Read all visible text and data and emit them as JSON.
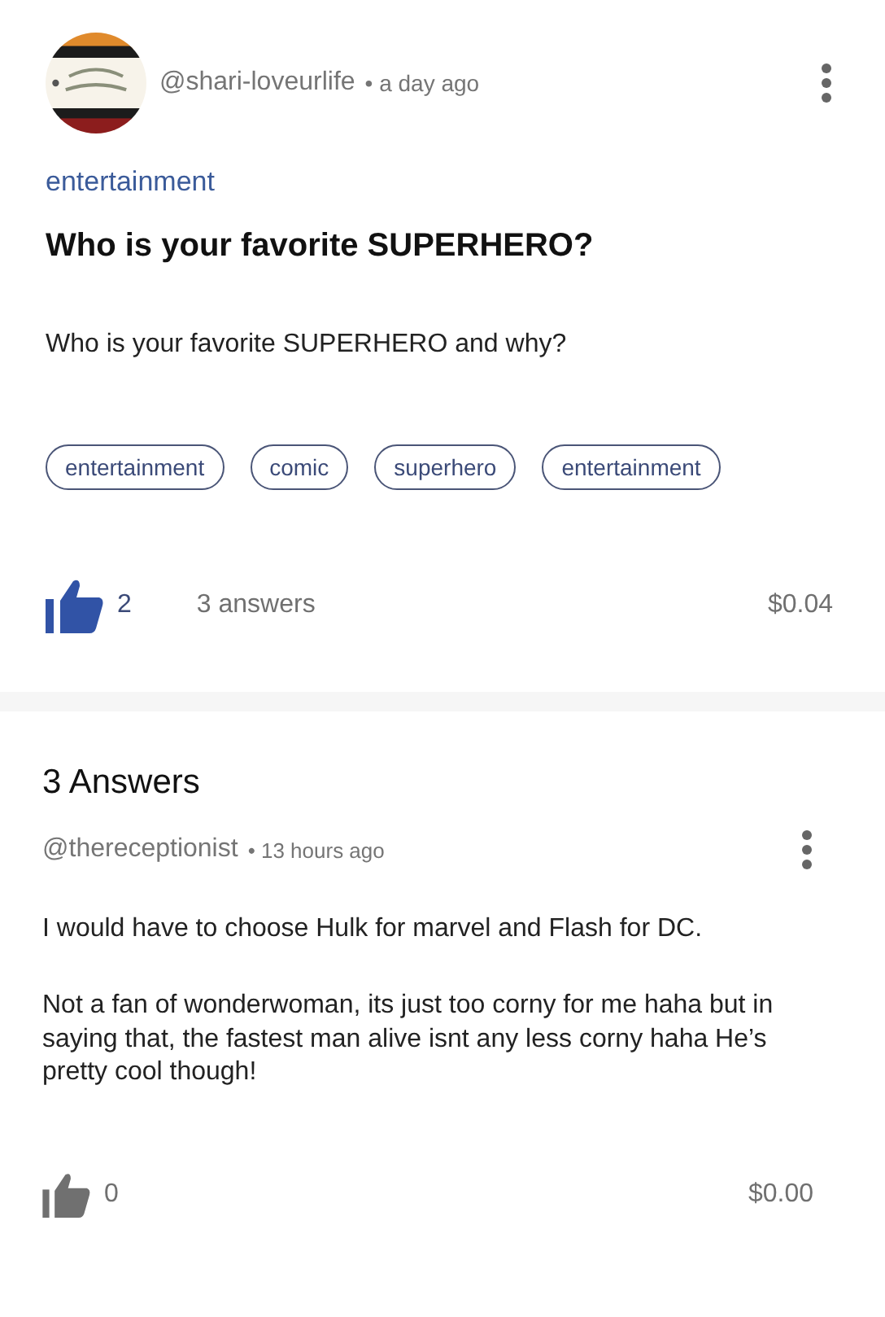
{
  "question": {
    "author": "@shari-loveurlife",
    "time": "• a day ago",
    "category": "entertainment",
    "title": "Who is your favorite SUPERHERO?",
    "body": "Who is your favorite SUPERHERO and why?",
    "tags": [
      "entertainment",
      "comic",
      "superhero",
      "entertainment"
    ],
    "liked": true,
    "likes": "2",
    "answers_count": "3 answers",
    "earnings": "$0.04"
  },
  "answers_heading": "3 Answers",
  "answers": [
    {
      "author": "@thereceptionist",
      "time": "• 13 hours ago",
      "paragraphs": [
        "I would have to choose Hulk for marvel and Flash for DC.",
        "Not a fan of wonderwoman, its just too corny for me haha but in saying that, the fastest man alive isnt any less corny haha He’s pretty cool though!"
      ],
      "liked": false,
      "likes": "0",
      "earnings": "$0.00"
    }
  ]
}
